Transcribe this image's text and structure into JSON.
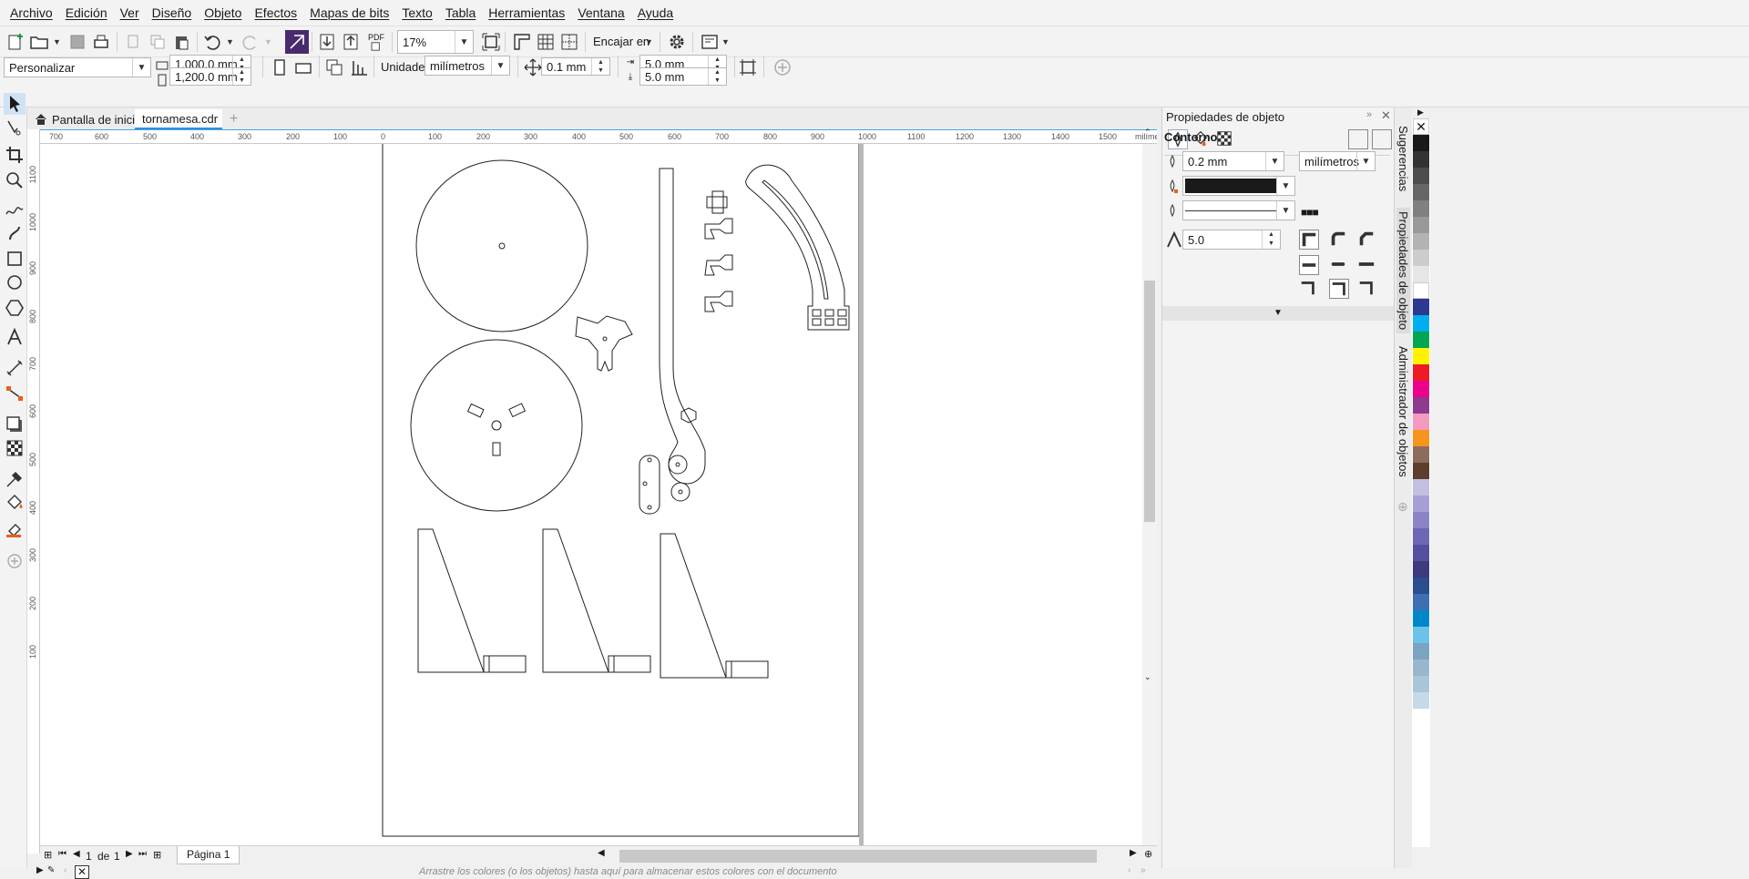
{
  "menubar": {
    "items": [
      "Archivo",
      "Edición",
      "Ver",
      "Diseño",
      "Objeto",
      "Efectos",
      "Mapas de bits",
      "Texto",
      "Tabla",
      "Herramientas",
      "Ventana",
      "Ayuda"
    ]
  },
  "toolbar": {
    "zoom_value": "17%",
    "snap_label": "Encajar en",
    "pdf_label": "PDF"
  },
  "property_bar": {
    "page_preset": "Personalizar",
    "page_width": "1,000.0 mm",
    "page_height": "1,200.0 mm",
    "units_label": "Unidades:",
    "units_value": "milímetros",
    "nudge_value": "0.1 mm",
    "dup_x": "5.0 mm",
    "dup_y": "5.0 mm"
  },
  "document_tabs": {
    "home_label": "Pantalla de inicio",
    "file_label": "tornamesa.cdr",
    "add_label": "+"
  },
  "ruler": {
    "h_labels": [
      "700",
      "600",
      "500",
      "400",
      "300",
      "200",
      "100",
      "0",
      "100",
      "200",
      "300",
      "400",
      "500",
      "600",
      "700",
      "800",
      "900",
      "1000",
      "1100",
      "1200",
      "1300",
      "1400",
      "1500",
      "milímetros"
    ],
    "v_labels": [
      "1100",
      "1000",
      "900",
      "800",
      "700",
      "600",
      "500",
      "400",
      "300",
      "200",
      "100"
    ]
  },
  "page_nav": {
    "current": "1",
    "of_label": "de",
    "total": "1",
    "page_tab": "Página 1"
  },
  "status": {
    "hint": "Arrastre los colores (o los objetos) hasta aquí para almacenar estos colores con el documento"
  },
  "docker": {
    "title": "Propiedades de objeto",
    "section": "Contorno",
    "width_value": "0.2 mm",
    "units_value": "milímetros",
    "miter_value": "5.0",
    "outline_color": "#1a1a1a"
  },
  "docker_tabs": {
    "hints": "Sugerencias",
    "props": "Propiedades de objeto",
    "objects": "Administrador de objetos"
  },
  "palette": {
    "colors": [
      "#ffffff",
      "#1a1a1a",
      "#333333",
      "#4d4d4d",
      "#666666",
      "#808080",
      "#999999",
      "#b3b3b3",
      "#cccccc",
      "#e6e6e6",
      "#ffffff",
      "#2b3990",
      "#00aeef",
      "#00a651",
      "#fff200",
      "#ed1c24",
      "#ec008c",
      "#8e3a8e",
      "#f49ac1",
      "#f7941d",
      "#8c6c5c",
      "#5c3d2e",
      "#c2c0e0",
      "#a59fd6",
      "#8a84c6",
      "#6f67b4",
      "#54509f",
      "#3e3a7d",
      "#2b4e8c",
      "#3c6fb4",
      "#0087c9",
      "#6cc3ea",
      "#7ba3c2",
      "#98b7cf",
      "#a9c6d8",
      "#c5d9e6"
    ]
  }
}
